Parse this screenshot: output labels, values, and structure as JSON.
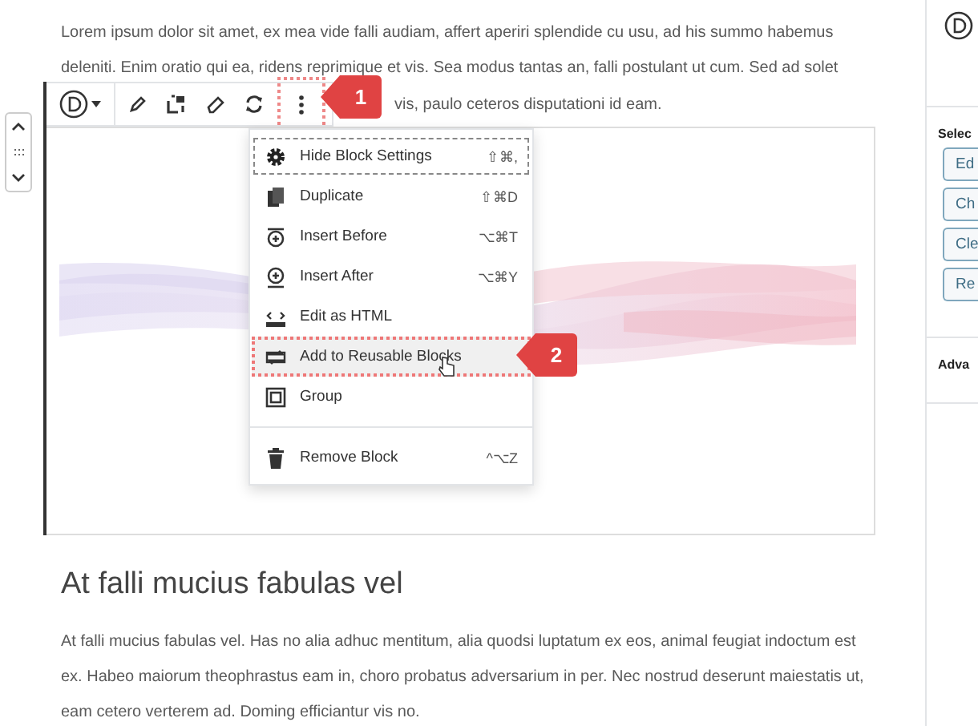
{
  "paragraph_1": "Lorem ipsum dolor sit amet, ex mea vide falli audiam, affert aperiri splendide cu usu, ad his summo habemus deleniti. Enim oratio qui ea, ridens reprimique et vis. Sea modus tantas an, falli postulant ut cum. Sed ad solet",
  "paragraph_1_visible_end": "vis, paulo ceteros disputationi id eam.",
  "block_menu": {
    "items": [
      {
        "label": "Hide Block Settings",
        "shortcut": "⇧⌘,",
        "focused": true,
        "hovered": false,
        "separator_before": false
      },
      {
        "label": "Duplicate",
        "shortcut": "⇧⌘D",
        "focused": false,
        "hovered": false,
        "separator_before": false
      },
      {
        "label": "Insert Before",
        "shortcut": "⌥⌘T",
        "focused": false,
        "hovered": false,
        "separator_before": false
      },
      {
        "label": "Insert After",
        "shortcut": "⌥⌘Y",
        "focused": false,
        "hovered": false,
        "separator_before": false
      },
      {
        "label": "Edit as HTML",
        "focused": false,
        "hovered": false,
        "separator_before": false
      },
      {
        "label": "Add to Reusable Blocks",
        "focused": false,
        "hovered": true,
        "separator_before": false
      },
      {
        "label": "Group",
        "focused": false,
        "hovered": false,
        "separator_before": false
      },
      {
        "label": "Remove Block",
        "shortcut": "^⌥Z",
        "focused": false,
        "hovered": false,
        "separator_before": true
      }
    ]
  },
  "callouts": [
    "1",
    "2"
  ],
  "heading": "At falli mucius fabulas vel",
  "paragraph_2": "At falli mucius fabulas vel. Has no alia adhuc mentitum, alia quodsi luptatum ex eos, animal feugiat indoctum est ex. Habeo maiorum theophrastus eam in, choro probatus adversarium in per. Nec nostrud deserunt maiestatis ut, eam cetero verterem ad. Doming efficiantur vis no.",
  "sidebar": {
    "section_1": "Selec",
    "buttons": [
      "Ed",
      "Ch",
      "Cle",
      "Re"
    ],
    "section_2": "Adva"
  }
}
